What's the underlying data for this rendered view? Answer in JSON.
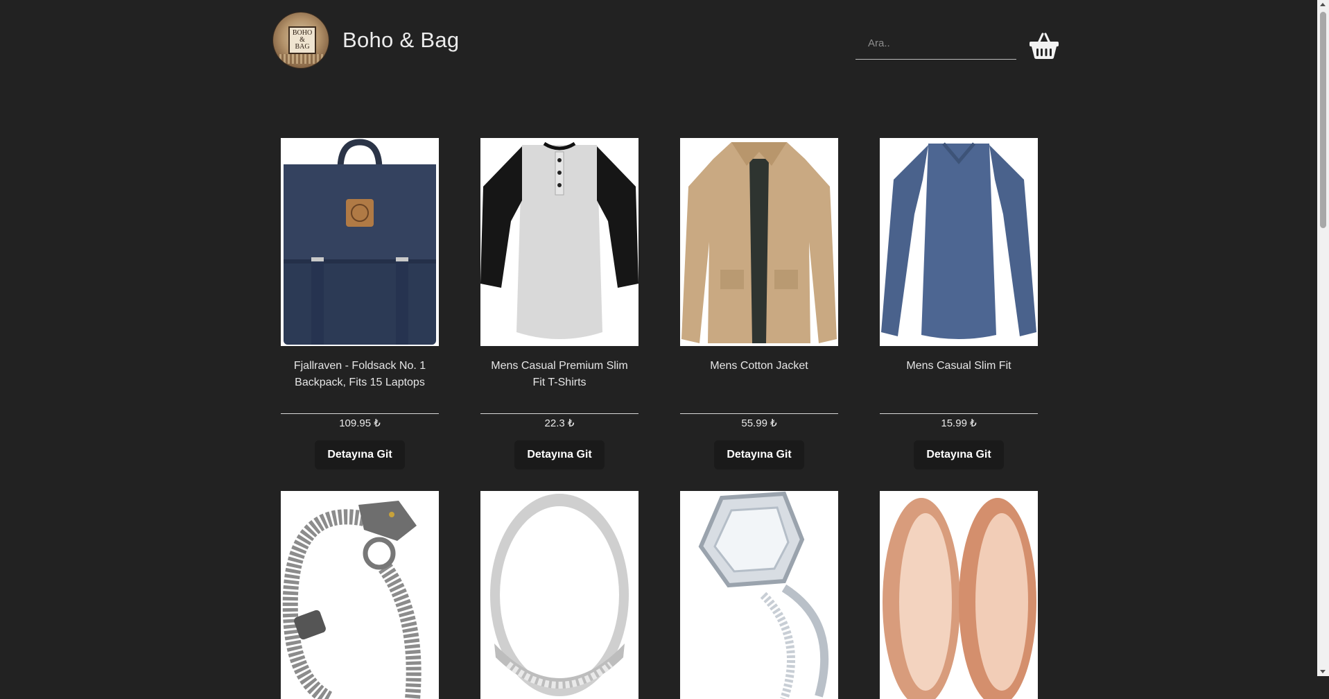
{
  "header": {
    "brand": "Boho & Bag",
    "logo_text": [
      "BOHO",
      "&",
      "BAG"
    ],
    "search_placeholder": "Ara..",
    "cart_icon": "basket-icon"
  },
  "products": [
    {
      "title": "Fjallraven - Foldsack No. 1 Backpack, Fits 15 Laptops",
      "price": "109.95 ₺",
      "button": "Detayına Git",
      "image": "backpack-image"
    },
    {
      "title": "Mens Casual Premium Slim Fit T-Shirts",
      "price": "22.3 ₺",
      "button": "Detayına Git",
      "image": "tshirt-image"
    },
    {
      "title": "Mens Cotton Jacket",
      "price": "55.99 ₺",
      "button": "Detayına Git",
      "image": "jacket-image"
    },
    {
      "title": "Mens Casual Slim Fit",
      "price": "15.99 ₺",
      "button": "Detayına Git",
      "image": "longsleeve-image"
    },
    {
      "title": "",
      "price": "",
      "button": "",
      "image": "bracelet-image"
    },
    {
      "title": "",
      "price": "",
      "button": "",
      "image": "silver-ring-image"
    },
    {
      "title": "",
      "price": "",
      "button": "",
      "image": "diamond-ring-image"
    },
    {
      "title": "",
      "price": "",
      "button": "",
      "image": "rose-gold-tunnel-image"
    }
  ],
  "colors": {
    "background": "#222222",
    "button": "#1a1a1a",
    "text": "#e9e9e9"
  }
}
